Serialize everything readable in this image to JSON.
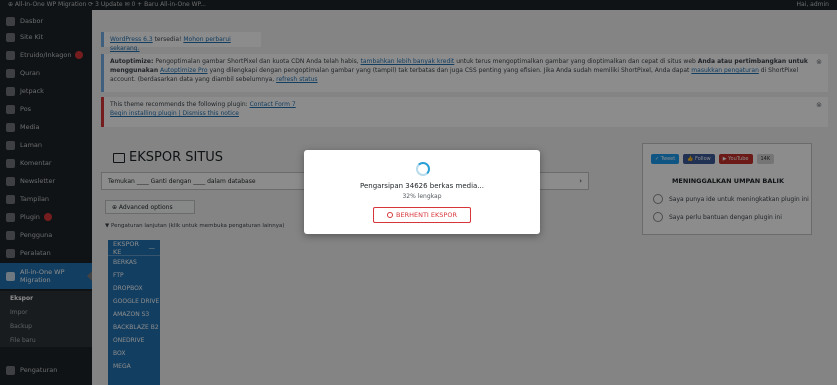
{
  "adminbar": {
    "left_text": "⊕  All-In-One WP Migration    ⟳ 3 Update    ✉ 0    + Baru    All-in-One WP...",
    "right_text": "Hai, admin"
  },
  "sidebar": {
    "items": [
      {
        "label": "Dasbor"
      },
      {
        "label": "Site Kit"
      },
      {
        "label": "Etruido/Inkagon"
      },
      {
        "label": "Quran"
      },
      {
        "label": "Jetpack"
      },
      {
        "label": "Pos"
      },
      {
        "label": "Media"
      },
      {
        "label": "Laman"
      },
      {
        "label": "Komentar"
      },
      {
        "label": "Newsletter"
      },
      {
        "label": "Tampilan"
      },
      {
        "label": "Plugin"
      },
      {
        "label": "Pengguna"
      },
      {
        "label": "Peralatan"
      },
      {
        "label": "All-in-One WP Migration"
      }
    ],
    "subitems": [
      {
        "label": "Ekspor"
      },
      {
        "label": "Impor"
      },
      {
        "label": "Backup"
      },
      {
        "label": "File baru"
      }
    ],
    "bottom": {
      "label": "Pengaturan"
    }
  },
  "notices": {
    "update": {
      "link": "WordPress 6.3",
      "text": " tersedia! ",
      "link2": "Mohon perbarui sekarang."
    },
    "autoptimize": {
      "lead": "Autoptimize:",
      "text1": " Pengoptimalan gambar ShortPixel dan kuota CDN Anda telah habis, ",
      "link1": "tambahkan lebih banyak kredit",
      "text2": " untuk terus mengoptimalkan gambar yang dioptimalkan dan cepat di situs web ",
      "bold": "Anda atau pertimbangkan untuk menggunakan",
      "link2": "Autoptimize Pro",
      "text3": " yang dilengkapi dengan pengoptimalan gambar yang (tampil) tak terbatas dan juga CSS penting yang efisien. Jika Anda sudah memiliki ShortPixel, Anda dapat ",
      "link3": "masukkan pengaturan",
      "text4": " di ShortPixel account. (berdasarkan data yang diambil sebelumnya, ",
      "link4": "refresh status"
    },
    "theme": {
      "text": "This theme recommends the following plugin: ",
      "link": "Contact Form 7",
      "link2": "Begin installing plugin | Dismiss this notice"
    }
  },
  "main": {
    "title": "EKSPOR SITUS",
    "find_text": "Temukan  ____  Ganti dengan  ____  dalam database",
    "advanced_btn": "⊕ Advanced options",
    "advanced_note": "▼ Pengaturan lanjutan (klik untuk membuka pengaturan lainnya)",
    "export_to": "EKSPOR KE",
    "export_options": [
      "BERKAS",
      "FTP",
      "DROPBOX",
      "GOOGLE DRIVE",
      "AMAZON S3",
      "BACKBLAZE B2",
      "ONEDRIVE",
      "BOX",
      "MEGA"
    ]
  },
  "right_panel": {
    "buttons": [
      {
        "label": "✓ Tweet",
        "color": "#1d9bf0"
      },
      {
        "label": "👍 Follow",
        "color": "#3b5998"
      },
      {
        "label": "▶ YouTube",
        "color": "#c4302b"
      },
      {
        "label": "14K",
        "color": "#d5d5d5"
      }
    ],
    "title": "MENINGGALKAN UMPAN BALIK",
    "opt1": "Saya punya ide untuk meningkatkan plugin ini",
    "opt2": "Saya perlu bantuan dengan plugin ini"
  },
  "modal": {
    "message": "Pengarsipan 34626 berkas media...",
    "progress_text": "32% lengkap",
    "progress": 0.32,
    "stop_label": "BERHENTI EKSPOR"
  },
  "colors": {
    "accent": "#2271b1",
    "danger": "#d63638",
    "sidebar": "#1d2327"
  }
}
